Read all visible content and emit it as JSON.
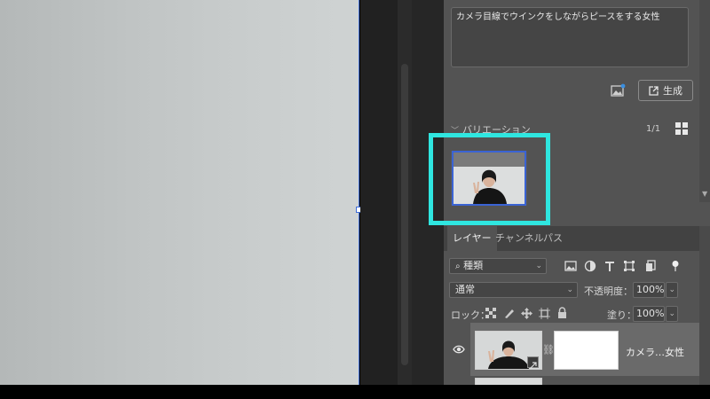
{
  "prompt": {
    "text": "カメラ目線でウインクをしながらピースをする女性"
  },
  "generate": {
    "label": "生成",
    "icon": "external-generate-icon",
    "thumb_icon": "image-reference-icon"
  },
  "variations": {
    "title": "バリエーション",
    "count": "1/1",
    "view_icon": "grid-view-icon"
  },
  "highlight_color": "#2fe6e0",
  "layers_panel": {
    "tabs": [
      {
        "label": "レイヤー",
        "active": true
      },
      {
        "label": "チャンネル",
        "active": false
      },
      {
        "label": "パス",
        "active": false
      }
    ],
    "filter": {
      "kind": "種類"
    },
    "blend_mode": "通常",
    "opacity_label": "不透明度：",
    "opacity_value": "100%",
    "lock_label": "ロック：",
    "fill_label": "塗り：",
    "fill_value": "100%",
    "layers": [
      {
        "name": "カメラ…女性",
        "visible": true,
        "selected": true
      }
    ]
  }
}
